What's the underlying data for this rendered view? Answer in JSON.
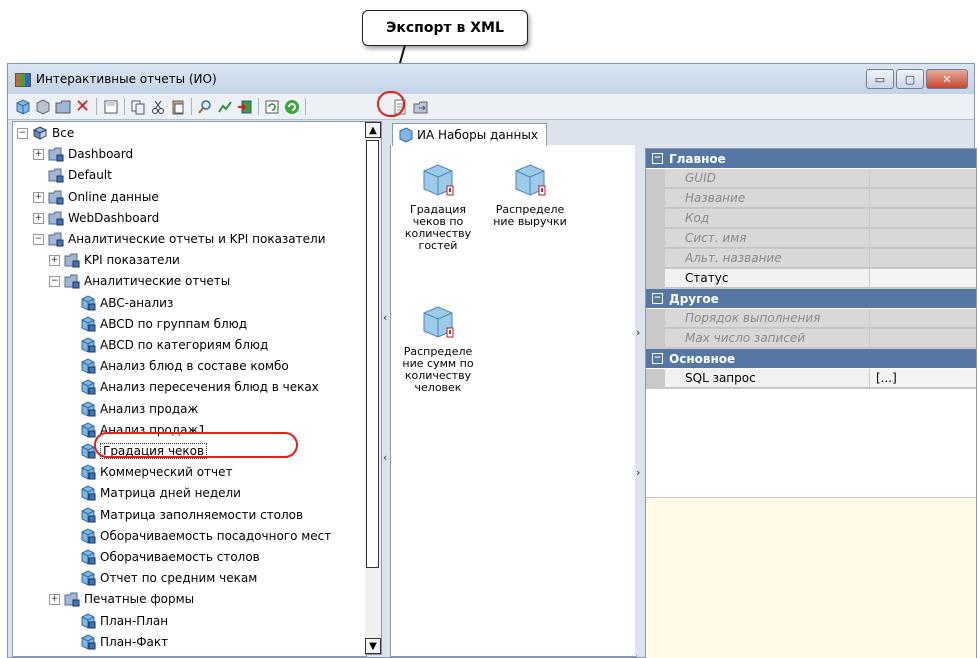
{
  "callout": {
    "label": "Экспорт в XML"
  },
  "window": {
    "title": "Интерактивные отчеты (ИО)",
    "controls": {
      "minimize": "▭",
      "maximize": "▢",
      "close": "✕"
    }
  },
  "toolbar": {
    "icons": [
      "cube-icon",
      "cube-grey-icon",
      "folder-icon",
      "delete-icon",
      "save-icon",
      "copy-icon",
      "cut-icon",
      "paste-icon",
      "find-icon",
      "chart-icon",
      "import-icon",
      "refresh-icon",
      "reload-icon",
      "export-xml-icon",
      "folder-export-icon"
    ]
  },
  "tree": {
    "items": [
      {
        "label": "Все",
        "indent": 0,
        "expander": "−",
        "icon": "root"
      },
      {
        "label": "Dashboard",
        "indent": 1,
        "expander": "+",
        "icon": "folder"
      },
      {
        "label": "Default",
        "indent": 1,
        "expander": "",
        "icon": "folder"
      },
      {
        "label": "Online данные",
        "indent": 1,
        "expander": "+",
        "icon": "folder"
      },
      {
        "label": "WebDashboard",
        "indent": 1,
        "expander": "+",
        "icon": "folder"
      },
      {
        "label": "Аналитические отчеты и KPI показатели",
        "indent": 1,
        "expander": "−",
        "icon": "folder"
      },
      {
        "label": "KPI показатели",
        "indent": 2,
        "expander": "+",
        "icon": "folder"
      },
      {
        "label": "Аналитические отчеты",
        "indent": 2,
        "expander": "−",
        "icon": "folder"
      },
      {
        "label": "ABC-анализ",
        "indent": 3,
        "expander": "",
        "icon": "cube"
      },
      {
        "label": "ABCD по группам блюд",
        "indent": 3,
        "expander": "",
        "icon": "cube"
      },
      {
        "label": "ABCD по категориям блюд",
        "indent": 3,
        "expander": "",
        "icon": "cube"
      },
      {
        "label": "Анализ блюд в составе комбо",
        "indent": 3,
        "expander": "",
        "icon": "cube"
      },
      {
        "label": "Анализ пересечения блюд в чеках",
        "indent": 3,
        "expander": "",
        "icon": "cube"
      },
      {
        "label": "Анализ продаж",
        "indent": 3,
        "expander": "",
        "icon": "cube"
      },
      {
        "label": "Анализ продаж1",
        "indent": 3,
        "expander": "",
        "icon": "cube"
      },
      {
        "label": "Градация чеков",
        "indent": 3,
        "expander": "",
        "icon": "cube",
        "selected": true
      },
      {
        "label": "Коммерческий отчет",
        "indent": 3,
        "expander": "",
        "icon": "cube"
      },
      {
        "label": "Матрица дней недели",
        "indent": 3,
        "expander": "",
        "icon": "cube"
      },
      {
        "label": "Матрица заполняемости столов",
        "indent": 3,
        "expander": "",
        "icon": "cube"
      },
      {
        "label": "Оборачиваемость посадочного мест",
        "indent": 3,
        "expander": "",
        "icon": "cube"
      },
      {
        "label": "Оборачиваемость столов",
        "indent": 3,
        "expander": "",
        "icon": "cube"
      },
      {
        "label": "Отчет по средним чекам",
        "indent": 3,
        "expander": "",
        "icon": "cube"
      },
      {
        "label": "Печатные формы",
        "indent": 2,
        "expander": "+",
        "icon": "folder"
      },
      {
        "label": "План-План",
        "indent": 3,
        "expander": "",
        "icon": "cube"
      },
      {
        "label": "План-Факт",
        "indent": 3,
        "expander": "",
        "icon": "cube"
      }
    ]
  },
  "middle": {
    "tab_label": "ИА Наборы данных",
    "datasets": [
      {
        "label": "Градация чеков по количеству гостей"
      },
      {
        "label": "Распределе ние выручки"
      },
      {
        "label": "Распределе ние сумм по количеству человек"
      }
    ]
  },
  "properties": {
    "categories": [
      {
        "title": "Главное",
        "rows": [
          {
            "name": "GUID",
            "value": "",
            "disabled": true
          },
          {
            "name": "Название",
            "value": "",
            "disabled": true
          },
          {
            "name": "Код",
            "value": "",
            "disabled": true
          },
          {
            "name": "Сист. имя",
            "value": "",
            "disabled": true
          },
          {
            "name": "Альт. название",
            "value": "",
            "disabled": true
          },
          {
            "name": "Статус",
            "value": "",
            "disabled": false
          }
        ]
      },
      {
        "title": "Другое",
        "rows": [
          {
            "name": "Порядок выполнения",
            "value": "",
            "disabled": true
          },
          {
            "name": "Max число записей",
            "value": "",
            "disabled": true
          }
        ]
      },
      {
        "title": "Основное",
        "rows": [
          {
            "name": "SQL запрос",
            "value": "[...]",
            "disabled": false
          }
        ]
      }
    ]
  },
  "colors": {
    "highlight": "#e0201a",
    "category_bg": "#5677a4",
    "help_bg": "#fffbe6"
  }
}
